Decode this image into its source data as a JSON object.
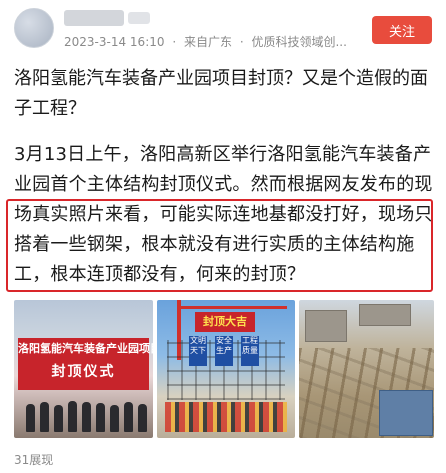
{
  "header": {
    "author_name": "",
    "meta": {
      "timestamp": "2023-3-14 16:10",
      "separator": "·",
      "source": "来自广东",
      "category": "优质科技领域创..."
    },
    "follow_label": "关注"
  },
  "article": {
    "title": "洛阳氢能汽车装备产业园项目封顶？又是个造假的面子工程？",
    "paragraph_before": "3月13日上午，洛阳高新区举行洛阳氢能汽车装备产业园首个主体结构封顶仪式。然而根据网友发布的现",
    "paragraph_highlight": "场真实照片来看，可能实际连地基都没打好，现场只搭着一些钢架，根本就没有进行实质的主体结构施工，根本连顶都没有，何来的封顶？"
  },
  "photos": [
    {
      "banner_line1": "洛阳氢能汽车装备产业园项目",
      "banner_line2": "封顶仪式"
    },
    {
      "sign": "封顶大吉",
      "panels": [
        "文明天下",
        "安全生产",
        "工程质量"
      ]
    },
    {}
  ],
  "footer": {
    "views": "31展现"
  },
  "colors": {
    "follow_button": "#e84c3d",
    "highlight_border": "#d9262a",
    "banner_red": "#c7242b",
    "meta_gray": "#8a8a8a"
  }
}
